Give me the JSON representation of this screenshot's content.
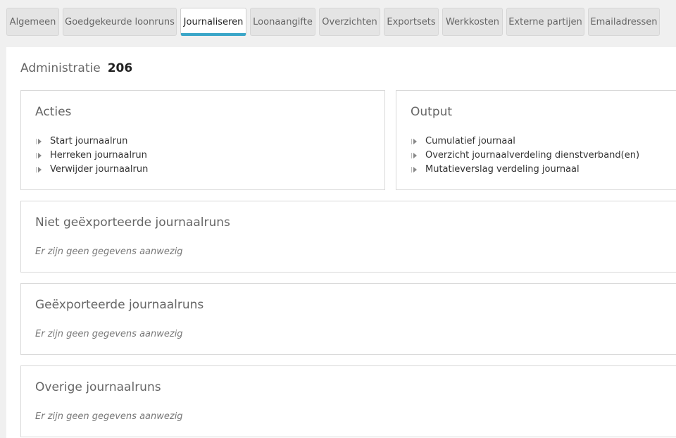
{
  "tabs": [
    {
      "label": "Algemeen",
      "active": false
    },
    {
      "label": "Goedgekeurde loonruns",
      "active": false
    },
    {
      "label": "Journaliseren",
      "active": true
    },
    {
      "label": "Loonaangifte",
      "active": false
    },
    {
      "label": "Overzichten",
      "active": false
    },
    {
      "label": "Exportsets",
      "active": false
    },
    {
      "label": "Werkkosten",
      "active": false
    },
    {
      "label": "Externe partijen",
      "active": false
    },
    {
      "label": "Emailadressen",
      "active": false
    }
  ],
  "administratie": {
    "label": "Administratie",
    "number": "206"
  },
  "acties": {
    "title": "Acties",
    "items": [
      "Start journaalrun",
      "Herreken journaalrun",
      "Verwijder journaalrun"
    ]
  },
  "output": {
    "title": "Output",
    "items": [
      "Cumulatief journaal",
      "Overzicht journaalverdeling dienstverband(en)",
      "Mutatieverslag verdeling journaal"
    ]
  },
  "sections": [
    {
      "title": "Niet geëxporteerde journaalruns",
      "empty_text": "Er zijn geen gegevens aanwezig"
    },
    {
      "title": "Geëxporteerde journaalruns",
      "empty_text": "Er zijn geen gegevens aanwezig"
    },
    {
      "title": "Overige journaalruns",
      "empty_text": "Er zijn geen gegevens aanwezig"
    }
  ],
  "colors": {
    "accent": "#3aa6c8",
    "background": "#f0f0f0",
    "panel_border": "#d9d9d9"
  }
}
